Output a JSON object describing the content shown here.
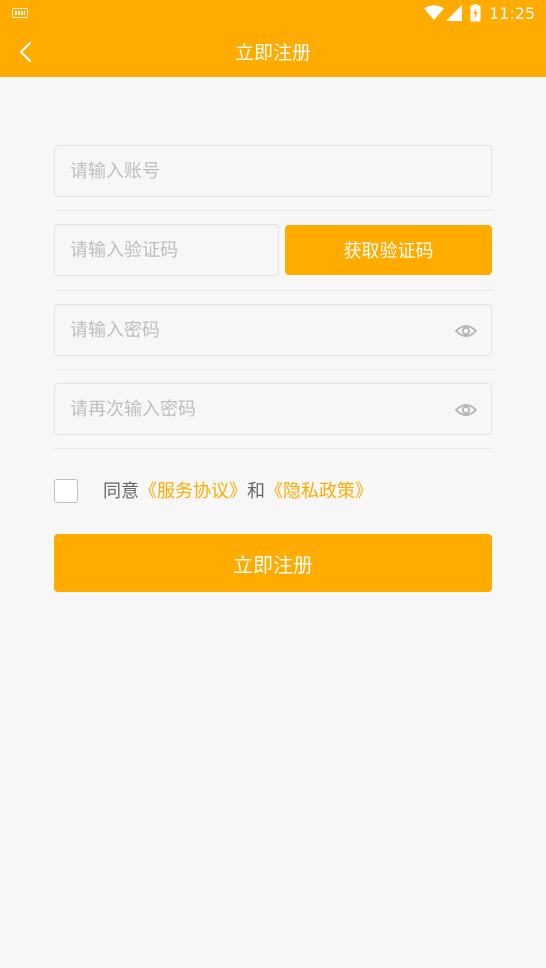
{
  "status_bar": {
    "time": "11:25",
    "icons": [
      "keyboard-icon",
      "wifi-icon",
      "signal-icon",
      "battery-icon"
    ]
  },
  "header": {
    "title": "立即注册",
    "back_icon": "chevron-left-icon"
  },
  "form": {
    "account_placeholder": "请输入账号",
    "code_placeholder": "请输入验证码",
    "get_code_label": "获取验证码",
    "password_placeholder": "请输入密码",
    "confirm_password_placeholder": "请再次输入密码",
    "visibility_icon": "eye-icon"
  },
  "agreement": {
    "checked": false,
    "prefix": "同意",
    "service_link": "《服务协议》",
    "conjunction": "和",
    "privacy_link": "《隐私政策》"
  },
  "submit_label": "立即注册",
  "colors": {
    "accent": "#ffab00",
    "background": "#f7f7f7",
    "placeholder": "#bdbdbd",
    "border": "#e3e3e3",
    "text_secondary": "#666666"
  }
}
